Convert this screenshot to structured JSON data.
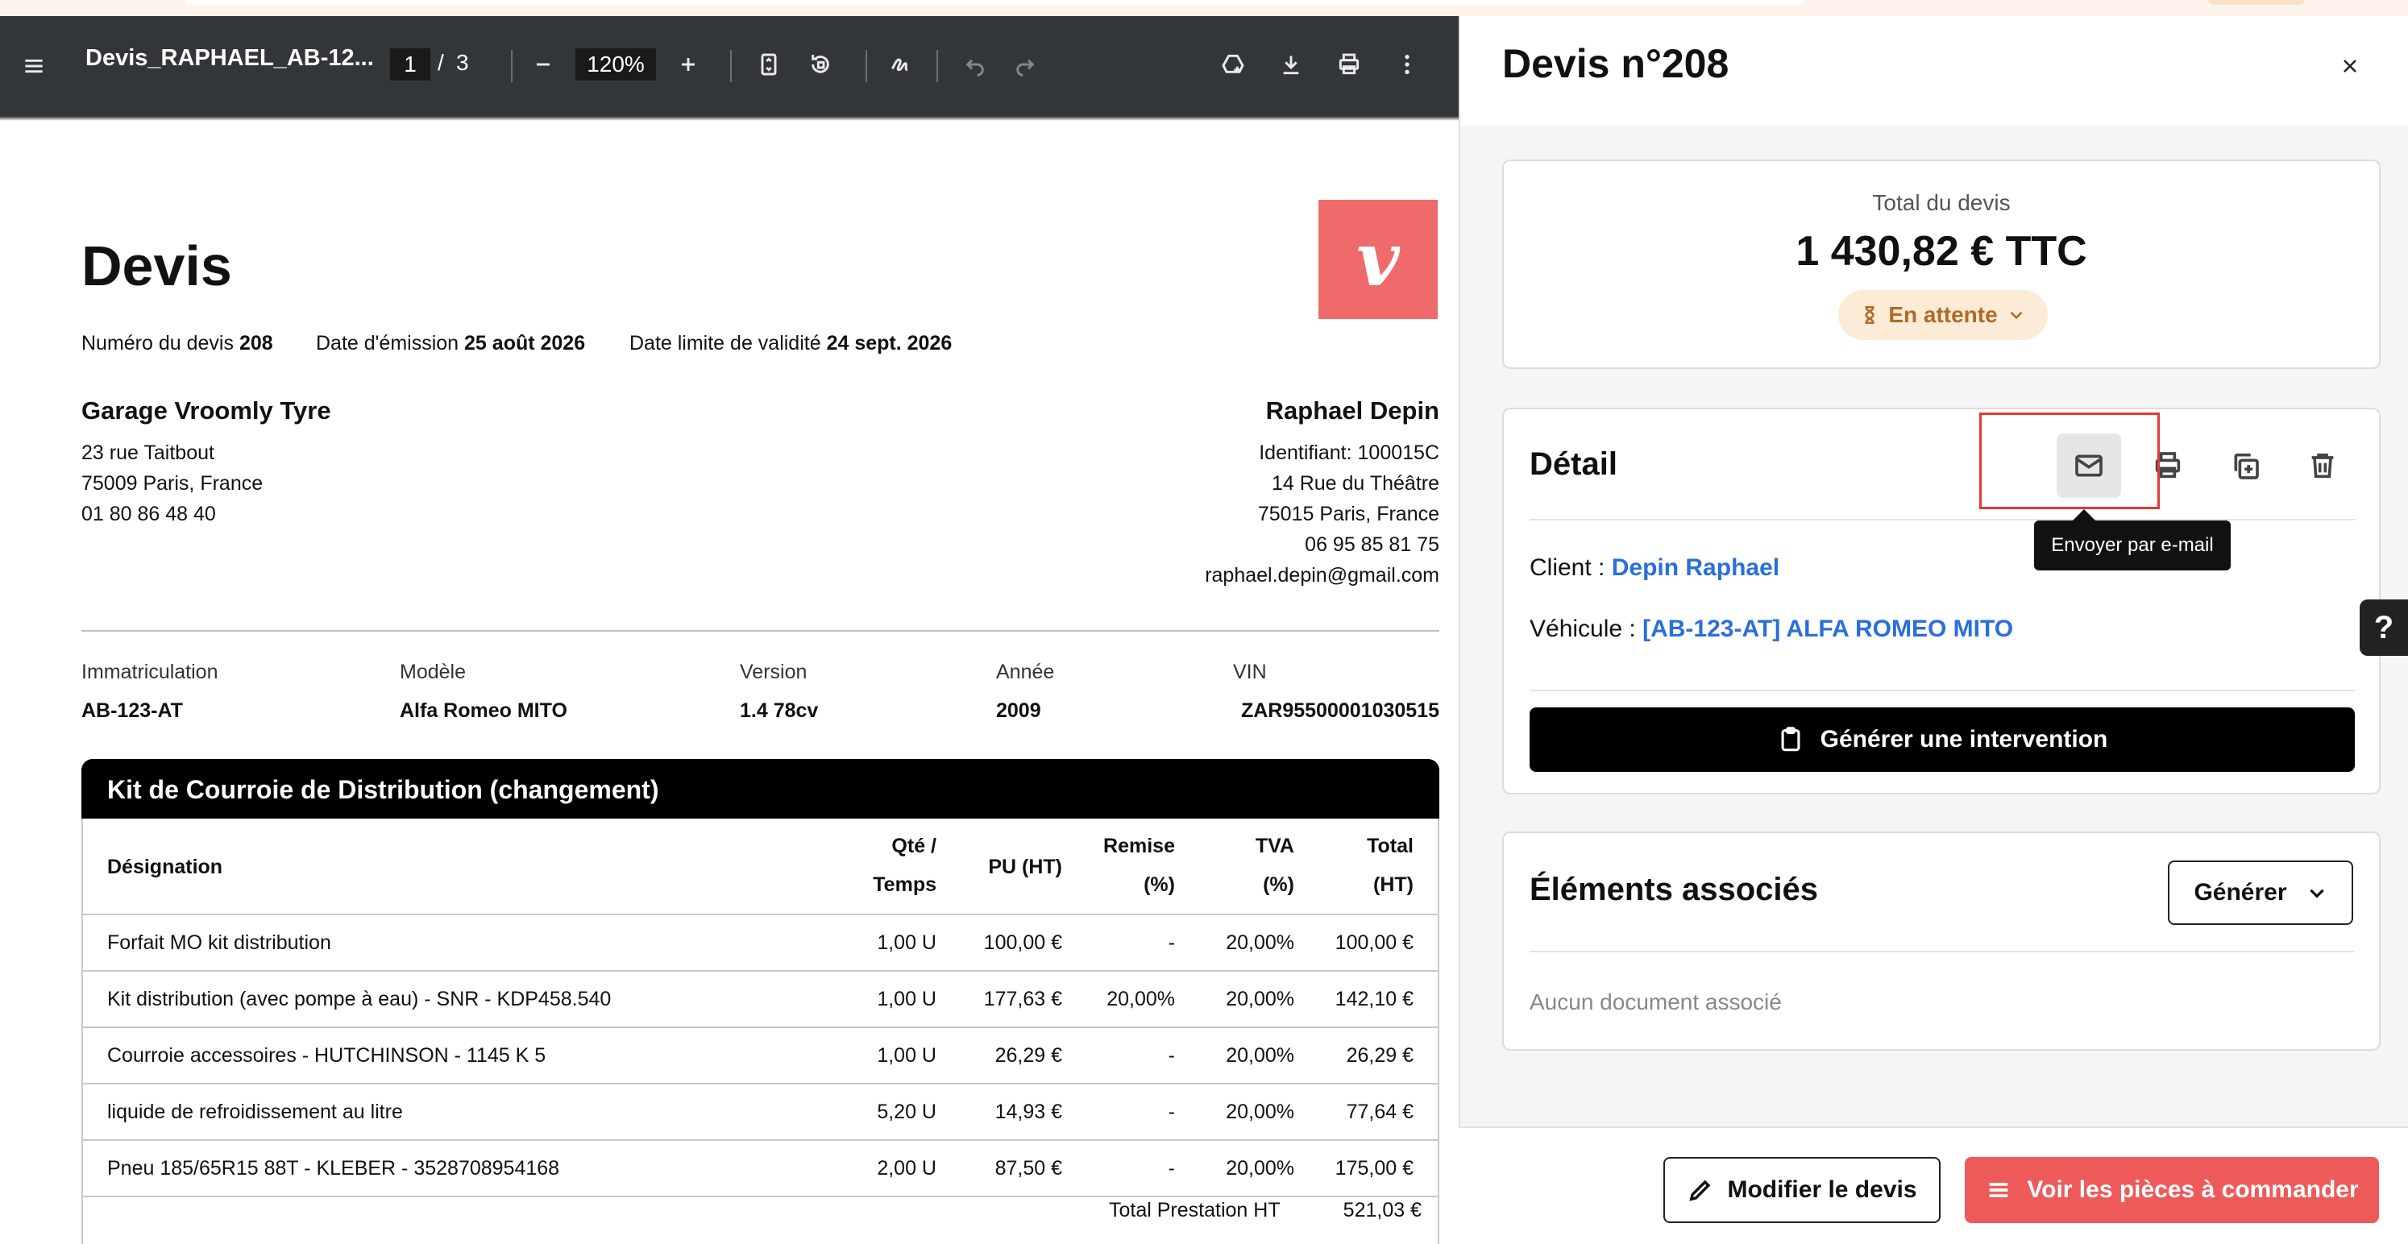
{
  "pdf_viewer": {
    "title": "Devis_RAPHAEL_AB-12...",
    "page_current": "1",
    "page_sep": "/",
    "page_total": "3",
    "zoom": "120%"
  },
  "document": {
    "heading": "Devis",
    "logo_letter": "v",
    "meta": {
      "number_label": "Numéro du devis",
      "number": "208",
      "issue_label": "Date d'émission",
      "issue": "25 août 2026",
      "valid_label": "Date limite de validité",
      "valid": "24 sept. 2026"
    },
    "garage": {
      "name": "Garage Vroomly Tyre",
      "lines": [
        "23 rue Taitbout",
        "75009 Paris, France",
        "01 80 86 48 40"
      ]
    },
    "client": {
      "name": "Raphael Depin",
      "lines": [
        "Identifiant: 100015C",
        "14 Rue du Théâtre",
        "75015 Paris, France",
        "06 95 85 81 75",
        "raphael.depin@gmail.com"
      ]
    },
    "vehicle": {
      "labels": [
        "Immatriculation",
        "Modèle",
        "Version",
        "Année",
        "VIN"
      ],
      "values": [
        "AB-123-AT",
        "Alfa Romeo MITO",
        "1.4 78cv",
        "2009",
        "ZAR95500001030515"
      ]
    },
    "section_title": "Kit de Courroie de Distribution (changement)",
    "table": {
      "headers": {
        "designation": "Désignation",
        "qty_1": "Qté /",
        "qty_2": "Temps",
        "pu": "PU (HT)",
        "remise_1": "Remise",
        "remise_2": "(%)",
        "tva_1": "TVA",
        "tva_2": "(%)",
        "total_1": "Total",
        "total_2": "(HT)"
      },
      "rows": [
        [
          "Forfait MO kit distribution",
          "1,00 U",
          "100,00 €",
          "-",
          "20,00%",
          "100,00 €"
        ],
        [
          "Kit distribution (avec pompe à eau) - SNR - KDP458.540",
          "1,00 U",
          "177,63 €",
          "20,00%",
          "20,00%",
          "142,10 €"
        ],
        [
          "Courroie accessoires - HUTCHINSON - 1145 K 5",
          "1,00 U",
          "26,29 €",
          "-",
          "20,00%",
          "26,29 €"
        ],
        [
          "liquide de refroidissement au litre",
          "5,20 U",
          "14,93 €",
          "-",
          "20,00%",
          "77,64 €"
        ],
        [
          "Pneu 185/65R15 88T - KLEBER - 3528708954168",
          "2,00 U",
          "87,50 €",
          "-",
          "20,00%",
          "175,00 €"
        ]
      ]
    },
    "totals": {
      "label": "Total Prestation HT",
      "value": "521,03 €"
    }
  },
  "panel": {
    "title": "Devis n°208",
    "total_label": "Total du devis",
    "total_amount": "1 430,82 € TTC",
    "status": "En attente",
    "detail": {
      "title": "Détail",
      "tooltip": "Envoyer par e-mail",
      "client_label": "Client :",
      "client_value": "Depin Raphael",
      "vehicle_label": "Véhicule :",
      "vehicle_value": "[AB-123-AT] ALFA ROMEO MITO",
      "generate_button": "Générer une intervention"
    },
    "associated": {
      "title": "Éléments associés",
      "generate_button": "Générer",
      "empty": "Aucun document associé"
    },
    "help": "?",
    "footer": {
      "edit_button": "Modifier le devis",
      "parts_button": "Voir les pièces à commander"
    }
  },
  "colors": {
    "accent_red": "#ee5a5a",
    "logo_red": "#ef6a6a",
    "link_blue": "#2a6fdb",
    "status_bg": "#fcebd7",
    "status_text": "#b06a28"
  }
}
